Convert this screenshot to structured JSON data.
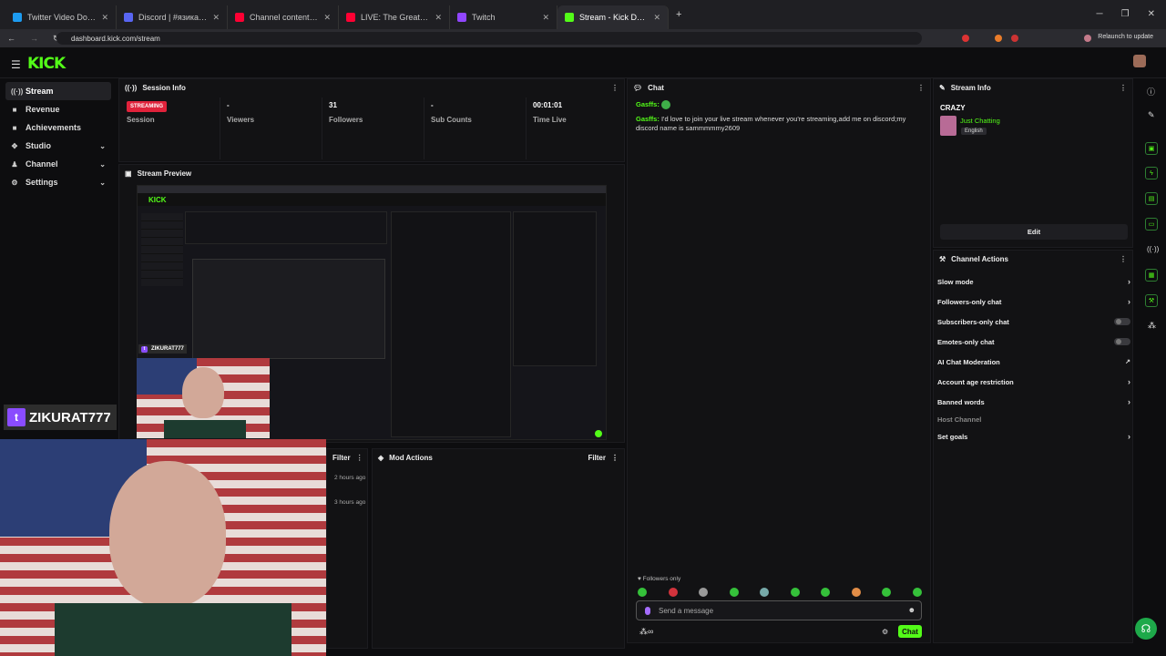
{
  "browser": {
    "tabs": [
      {
        "title": "Twitter Video Downloader - Do",
        "color": "#1d9bf0"
      },
      {
        "title": "Discord | #язиканще | Faffair",
        "color": "#5865f2"
      },
      {
        "title": "Channel content - YouTube Stu",
        "color": "#ff0033"
      },
      {
        "title": "LIVE: The Great FREE SPEEC",
        "color": "#ff0033"
      },
      {
        "title": "Twitch",
        "color": "#9146ff"
      },
      {
        "title": "Stream - Kick Dashboard",
        "color": "#53fc18"
      }
    ],
    "url": "dashboard.kick.com/stream",
    "relaunch": "Relaunch to update"
  },
  "app": {
    "logo": "KICK"
  },
  "sidebar": {
    "items": [
      {
        "label": "Stream",
        "icon": "((·))",
        "chevron": ""
      },
      {
        "label": "Revenue",
        "icon": "■",
        "chevron": ""
      },
      {
        "label": "Achievements",
        "icon": "■",
        "chevron": ""
      },
      {
        "label": "Studio",
        "icon": "✥",
        "chevron": "⌄"
      },
      {
        "label": "Channel",
        "icon": "♟",
        "chevron": "⌄"
      },
      {
        "label": "Settings",
        "icon": "⚙",
        "chevron": "⌄"
      }
    ]
  },
  "session": {
    "title": "Session Info",
    "badge": "STREAMING",
    "session_label": "Session",
    "viewers_value": "-",
    "viewers_label": "Viewers",
    "followers_value": "31",
    "followers_label": "Followers",
    "subs_value": "-",
    "subs_label": "Sub Counts",
    "time_value": "00:01:01",
    "time_label": "Time Live"
  },
  "preview": {
    "title": "Stream Preview",
    "mini_logo": "KICK"
  },
  "overlay": {
    "username_small": "ZIKURAT777",
    "username_large": "ZIKURAT777"
  },
  "lower": {
    "filter_left": "Filter",
    "times": [
      "2 hours ago",
      "3 hours ago"
    ],
    "mod_actions_title": "Mod Actions",
    "filter_right": "Filter"
  },
  "chat": {
    "title": "Chat",
    "messages": [
      {
        "user": "Gasffs:",
        "text": ""
      },
      {
        "user": "Gasffs:",
        "text": "I'd love to join your live stream whenever you're streaming,add me on discord;my discord name is sammmmmy2609"
      }
    ],
    "followers_only": "Followers only",
    "placeholder": "Send a message",
    "chat_button": "Chat",
    "infinity": "∞"
  },
  "stream_info": {
    "title": "Stream Info",
    "stream_title": "CRAZY",
    "category": "Just Chatting",
    "language": "English",
    "edit": "Edit"
  },
  "channel_actions": {
    "title": "Channel Actions",
    "items": [
      {
        "label": "Slow mode",
        "control": "›"
      },
      {
        "label": "Followers-only chat",
        "control": "›"
      },
      {
        "label": "Subscribers-only chat",
        "control": "toggle"
      },
      {
        "label": "Emotes-only chat",
        "control": "toggle"
      },
      {
        "label": "AI Chat Moderation",
        "control": "↗"
      },
      {
        "label": "Account age restriction",
        "control": "›"
      },
      {
        "label": "Banned words",
        "control": "›"
      },
      {
        "label": "Host Channel",
        "control": ""
      },
      {
        "label": "Set goals",
        "control": "›"
      }
    ]
  }
}
